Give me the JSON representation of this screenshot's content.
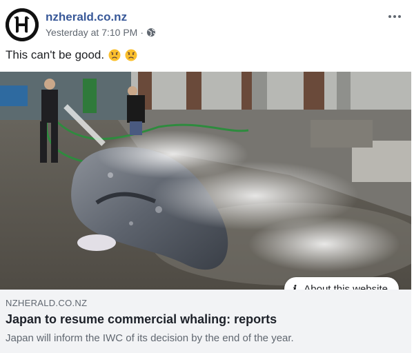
{
  "post": {
    "page_name": "nzherald.co.nz",
    "timestamp": "Yesterday at 7:10 PM",
    "separator": "·",
    "privacy_icon": "globe-icon",
    "more_icon": "more-options-icon",
    "message": "This can't be good.",
    "emojis": [
      "frowning-face-icon",
      "frowning-face-icon"
    ]
  },
  "photo": {
    "alt_icon": "whale-photo"
  },
  "about_button": {
    "icon": "info-icon",
    "label": "About this website"
  },
  "link": {
    "domain": "NZHERALD.CO.NZ",
    "title": "Japan to resume commercial whaling: reports",
    "description": "Japan will inform the IWC of its decision by the end of the year."
  },
  "colors": {
    "link_blue": "#385898",
    "meta_gray": "#606770",
    "link_box_bg": "#f2f3f5"
  }
}
